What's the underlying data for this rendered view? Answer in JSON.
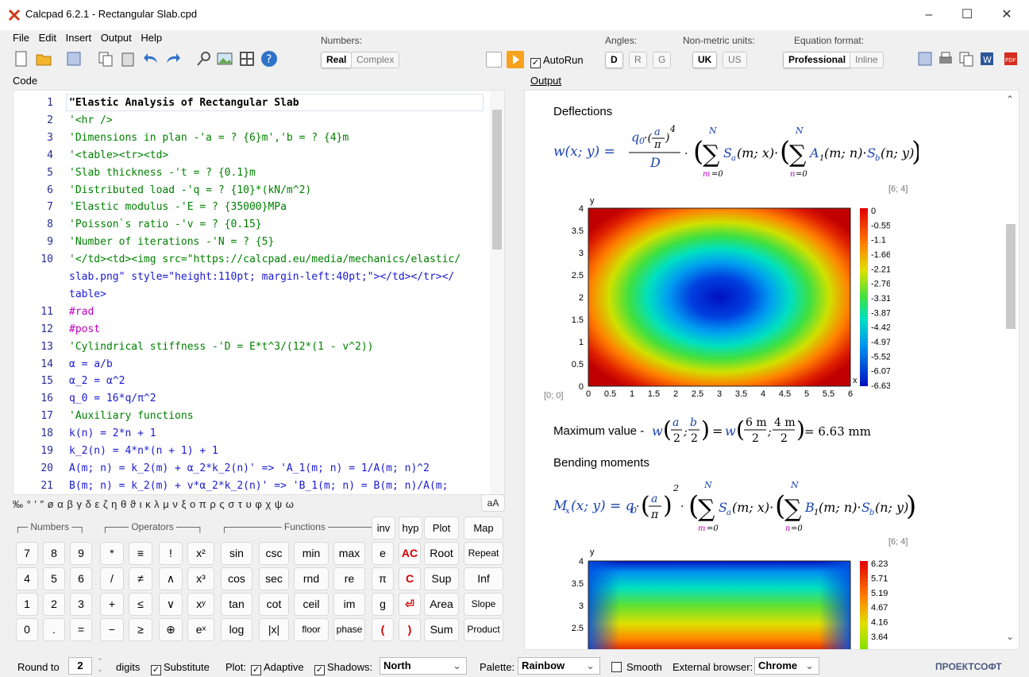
{
  "window": {
    "title": "Calcpad 6.2.1 - Rectangular Slab.cpd",
    "min": "–",
    "max": "☐",
    "close": "✕"
  },
  "menu": [
    "File",
    "Edit",
    "Insert",
    "Output",
    "Help"
  ],
  "toolbar": {
    "numbers_label": "Numbers:",
    "numbers": [
      "Real",
      "Complex"
    ],
    "autorun": "AutoRun",
    "angles_label": "Angles:",
    "angles": [
      "D",
      "R",
      "G"
    ],
    "units_label": "Non-metric units:",
    "units": [
      "UK",
      "US"
    ],
    "format_label": "Equation format:",
    "formats": [
      "Professional",
      "Inline"
    ]
  },
  "code": {
    "label": "Code",
    "lines": [
      {
        "n": "1",
        "t": "\"Elastic Analysis of Rectangular Slab"
      },
      {
        "n": "2",
        "t": "'<hr />"
      },
      {
        "n": "3",
        "t": "'Dimensions in plan -'a = ? {6}m','b = ? {4}m"
      },
      {
        "n": "4",
        "t": "'<table><tr><td>"
      },
      {
        "n": "5",
        "t": "'Slab thickness -'t = ? {0.1}m"
      },
      {
        "n": "6",
        "t": "'Distributed load -'q = ? {10}*(kN/m^2)"
      },
      {
        "n": "7",
        "t": "'Elastic modulus -'E = ? {35000}MPa"
      },
      {
        "n": "8",
        "t": "'Poisson`s ratio -'v = ? {0.15}"
      },
      {
        "n": "9",
        "t": "'Number of iterations -'N = ? {5}"
      },
      {
        "n": "10",
        "t": "'</td><td><img src=\"https://calcpad.eu/media/mechanics/elastic/"
      },
      {
        "n": "",
        "t": "slab.png\" style=\"height:110pt; margin-left:40pt;\"></td></tr></"
      },
      {
        "n": "",
        "t": "table>"
      },
      {
        "n": "11",
        "t": "#rad"
      },
      {
        "n": "12",
        "t": "#post"
      },
      {
        "n": "13",
        "t": "'Cylindrical stiffness -'D = E*t^3/(12*(1 - v^2))"
      },
      {
        "n": "14",
        "t": "α = a/b"
      },
      {
        "n": "15",
        "t": "α_2 = α^2"
      },
      {
        "n": "16",
        "t": "q_0 = 16*q/π^2"
      },
      {
        "n": "17",
        "t": "'Auxiliary functions"
      },
      {
        "n": "18",
        "t": "k(n) = 2*n + 1"
      },
      {
        "n": "19",
        "t": "k_2(n) = 4*n*(n + 1) + 1"
      },
      {
        "n": "20",
        "t": "A(m; n) = k_2(m) + α_2*k_2(n)' => 'A_1(m; n) = 1/A(m; n)^2"
      },
      {
        "n": "21",
        "t": "B(m; n) = k_2(m) + v*α_2*k_2(n)' => 'B_1(m; n) = B(m; n)/A(m;"
      },
      {
        "n": "",
        "t": "n)^2"
      }
    ]
  },
  "greek": "‰ °  ′  ″  ø  α  β  γ  δ  ε  ζ  η  θ  ϑ  ι  κ  λ  μ  ν  ξ  ο  π  ρ  ς  σ  τ  υ  φ  χ  ψ  ω",
  "greek_btn": "aA",
  "keypad": {
    "groups": [
      "Numbers",
      "Operators",
      "Functions"
    ],
    "rows": [
      [
        "inv",
        "hyp",
        "Plot",
        "Map"
      ],
      [
        "7",
        "8",
        "9",
        "*",
        "≡",
        "!",
        "x²",
        "sin",
        "csc",
        "min",
        "max",
        "e",
        "AC",
        "Root",
        "Repeat"
      ],
      [
        "4",
        "5",
        "6",
        "/",
        "≠",
        "∧",
        "x³",
        "cos",
        "sec",
        "rnd",
        "re",
        "π",
        "C",
        "Sup",
        "Inf"
      ],
      [
        "1",
        "2",
        "3",
        "+",
        "≤",
        "∨",
        "xʸ",
        "tan",
        "cot",
        "ceil",
        "im",
        "g",
        "⏎",
        "Area",
        "Slope"
      ],
      [
        "0",
        ".",
        "=",
        "−",
        "≥",
        "⊕",
        "eˣ",
        "log",
        "|x|",
        "floor",
        "phase",
        "(",
        ")",
        "Sum",
        "Product"
      ]
    ]
  },
  "output": {
    "label": "Output",
    "h1": "Deflections",
    "bounds1": "[6; 4]",
    "origin": "[0; 0]",
    "max_text": "Maximum value - ",
    "max_value": "= 6.63 mm",
    "h2": "Bending moments",
    "bounds2": "[6; 4]",
    "plot1": {
      "y_ticks": [
        "4",
        "3.5",
        "3",
        "2.5",
        "2",
        "1.5",
        "1",
        "0.5",
        "0"
      ],
      "x_ticks": [
        "0",
        "0.5",
        "1",
        "1.5",
        "2",
        "2.5",
        "3",
        "3.5",
        "4",
        "4.5",
        "5",
        "5.5",
        "6"
      ],
      "legend": [
        "0",
        "-0.552",
        "-1.1",
        "-1.66",
        "-2.21",
        "-2.76",
        "-3.31",
        "-3.87",
        "-4.42",
        "-4.97",
        "-5.52",
        "-6.07",
        "-6.63"
      ]
    },
    "plot2": {
      "y_ticks": [
        "4",
        "3.5",
        "3",
        "2.5"
      ],
      "legend": [
        "6.23",
        "5.71",
        "5.19",
        "4.67",
        "4.16",
        "3.64"
      ]
    }
  },
  "status": {
    "round_to": "Round to",
    "digits_value": "2",
    "digits": "digits",
    "substitute": "Substitute",
    "plot": "Plot:",
    "adaptive": "Adaptive",
    "shadows": "Shadows:",
    "shadows_value": "North",
    "palette": "Palette:",
    "palette_value": "Rainbow",
    "smooth": "Smooth",
    "browser": "External browser:",
    "browser_value": "Chrome",
    "logo": "ПРОЕКТСОФТ"
  }
}
